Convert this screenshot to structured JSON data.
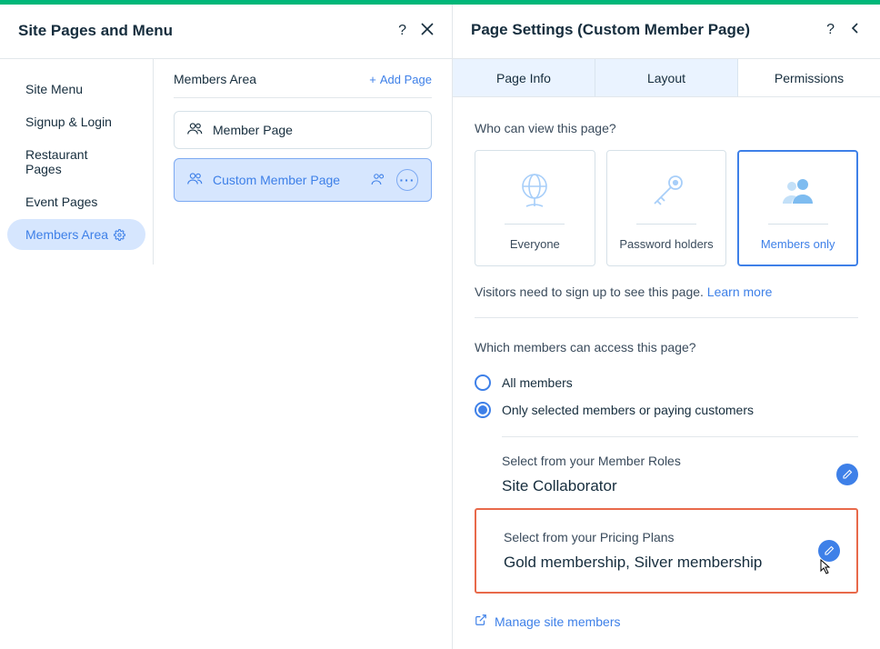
{
  "leftPanel": {
    "title": "Site Pages and Menu",
    "sidebar": {
      "items": [
        {
          "label": "Site Menu"
        },
        {
          "label": "Signup & Login"
        },
        {
          "label": "Restaurant Pages"
        },
        {
          "label": "Event Pages"
        },
        {
          "label": "Members Area"
        }
      ]
    },
    "pagesSection": {
      "title": "Members Area",
      "addLabel": "Add Page",
      "items": [
        {
          "label": "Member Page"
        },
        {
          "label": "Custom Member Page"
        }
      ]
    }
  },
  "rightPanel": {
    "title": "Page Settings (Custom Member Page)",
    "tabs": [
      {
        "label": "Page Info"
      },
      {
        "label": "Layout"
      },
      {
        "label": "Permissions"
      }
    ],
    "viewSection": {
      "question": "Who can view this page?",
      "options": [
        {
          "label": "Everyone"
        },
        {
          "label": "Password holders"
        },
        {
          "label": "Members only"
        }
      ],
      "hintPrefix": "Visitors need to sign up to see this page. ",
      "hintLink": "Learn more"
    },
    "accessSection": {
      "question": "Which members can access this page?",
      "radios": [
        {
          "label": "All members"
        },
        {
          "label": "Only selected members or paying customers"
        }
      ],
      "roles": {
        "label": "Select from your Member Roles",
        "value": "Site Collaborator"
      },
      "plans": {
        "label": "Select from your Pricing Plans",
        "value": "Gold membership, Silver membership"
      },
      "manageLink": "Manage site members"
    }
  }
}
